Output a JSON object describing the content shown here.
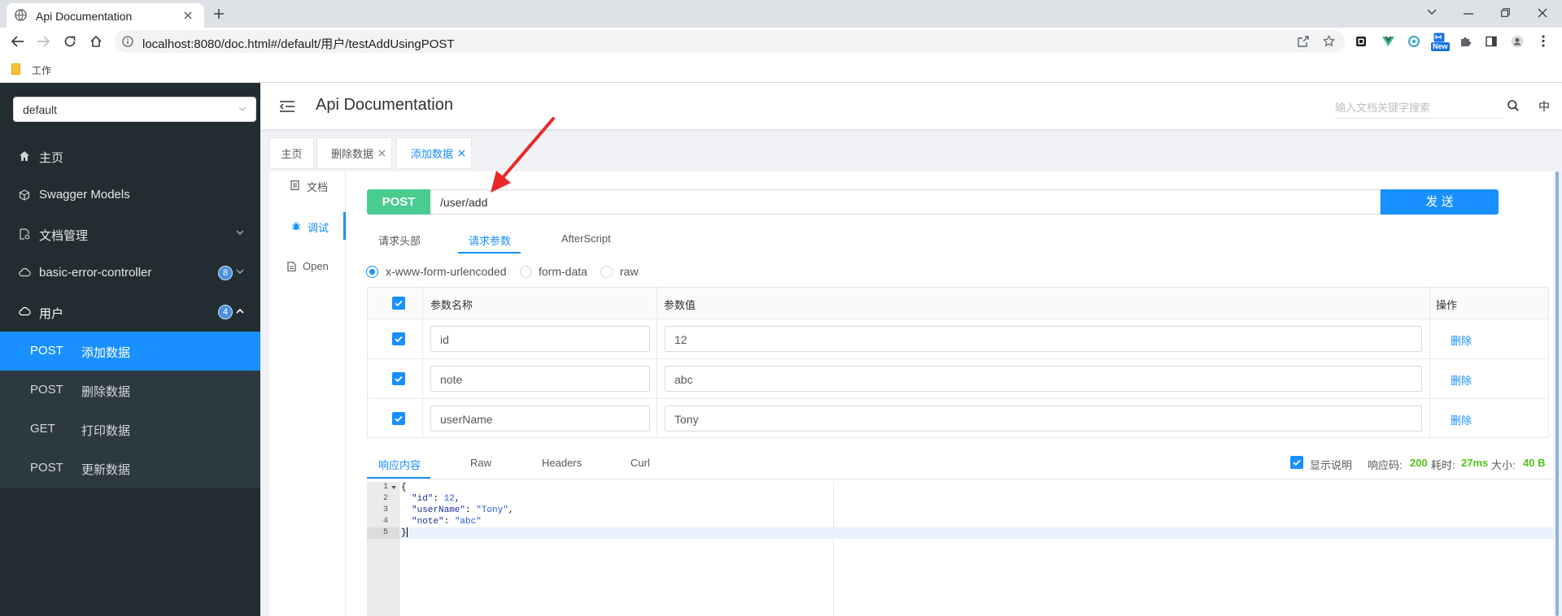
{
  "browser": {
    "tab_title": "Api Documentation",
    "url": "localhost:8080/doc.html#/default/用户/testAddUsingPOST",
    "bookmark": "工作",
    "extension_new_badge": "New",
    "icons": [
      "globe-icon",
      "close-icon",
      "plus-icon",
      "back-icon",
      "forward-icon",
      "reload-icon",
      "home-icon",
      "info-icon",
      "share-icon",
      "star-icon",
      "puzzle-icon",
      "sidepanel-icon",
      "profile-icon",
      "kebab-icon"
    ]
  },
  "sidebar": {
    "group_select": "default",
    "items": [
      {
        "label": "主页",
        "icon": "home-icon"
      },
      {
        "label": "Swagger Models",
        "icon": "cube-icon"
      },
      {
        "label": "文档管理",
        "icon": "doc-settings-icon"
      },
      {
        "label": "basic-error-controller",
        "icon": "cloud-icon",
        "badge": "8"
      },
      {
        "label": "用户",
        "icon": "cloud-icon",
        "badge": "4"
      }
    ],
    "submenu": [
      {
        "method": "POST",
        "label": "添加数据",
        "active": true
      },
      {
        "method": "POST",
        "label": "删除数据"
      },
      {
        "method": "GET",
        "label": "打印数据"
      },
      {
        "method": "POST",
        "label": "更新数据"
      }
    ]
  },
  "header": {
    "title": "Api Documentation",
    "search_placeholder": "输入文档关键字搜索",
    "lang": "中"
  },
  "page_tabs": [
    {
      "label": "主页"
    },
    {
      "label": "删除数据"
    },
    {
      "label": "添加数据",
      "active": true
    }
  ],
  "side_menu": [
    {
      "label": "文档",
      "icon": "document-icon"
    },
    {
      "label": "调试",
      "icon": "bug-icon",
      "active": true
    },
    {
      "label": "Open",
      "icon": "file-icon"
    }
  ],
  "request": {
    "method": "POST",
    "path": "/user/add",
    "send_label": "发 送",
    "sub_tabs": [
      "请求头部",
      "请求参数",
      "AfterScript"
    ],
    "active_sub_tab": "请求参数",
    "content_types": [
      "x-www-form-urlencoded",
      "form-data",
      "raw"
    ],
    "selected_content_type": "x-www-form-urlencoded"
  },
  "params_table": {
    "headers": {
      "name": "参数名称",
      "value": "参数值",
      "action": "操作"
    },
    "rows": [
      {
        "name": "id",
        "value": "12",
        "action": "删除",
        "checked": true
      },
      {
        "name": "note",
        "value": "abc",
        "action": "删除",
        "checked": true
      },
      {
        "name": "userName",
        "value": "Tony",
        "action": "删除",
        "checked": true
      }
    ]
  },
  "response": {
    "tabs": [
      "响应内容",
      "Raw",
      "Headers",
      "Curl"
    ],
    "show_desc_label": "显示说明",
    "code_label": "响应码:",
    "code": "200",
    "time_label": "耗时:",
    "time": "27ms",
    "size_label": "大小:",
    "size": "40 B",
    "lines": [
      {
        "num": "1",
        "text": "{"
      },
      {
        "num": "2",
        "key": "\"id\"",
        "colon": ": ",
        "value": "12",
        "comma": ","
      },
      {
        "num": "3",
        "key": "\"userName\"",
        "colon": ": ",
        "value": "\"Tony\"",
        "comma": ","
      },
      {
        "num": "4",
        "key": "\"note\"",
        "colon": ": ",
        "value": "\"abc\""
      },
      {
        "num": "5",
        "text": "}"
      }
    ]
  },
  "colors": {
    "primary": "#1890ff",
    "post_method": "#49cc90",
    "sidebar_bg": "#222d32",
    "success": "#52c41a",
    "annotation": "#e8282b"
  }
}
